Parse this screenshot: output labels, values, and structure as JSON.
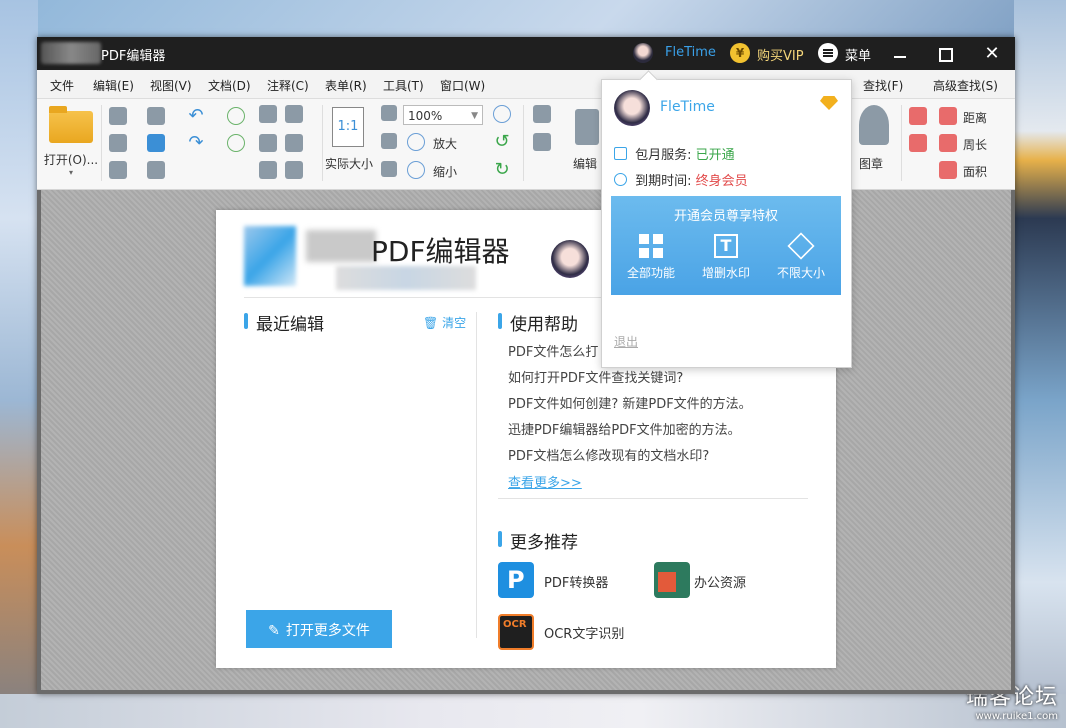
{
  "window": {
    "title": "PDF编辑器",
    "user_name": "FleTime",
    "vip_label": "购买VIP",
    "vip_icon_text": "¥",
    "menu_label": "菜单",
    "min_label": "",
    "close_label": "✕"
  },
  "menubar": {
    "items": [
      "文件",
      "编辑(E)",
      "视图(V)",
      "文档(D)",
      "注释(C)",
      "表单(R)",
      "工具(T)",
      "窗口(W)"
    ],
    "find_label": "查找(F)",
    "adv_find_label": "高级查找(S)"
  },
  "toolbar": {
    "open_label": "打开(O)...",
    "zoom_value": "100%",
    "actual_size_label": "实际大小",
    "actual_size_icon": "1:1",
    "zoom_in_label": "放大",
    "zoom_out_label": "缩小",
    "edit_label": "编辑",
    "stamp_label": "图章",
    "distance_label": "距离",
    "perimeter_label": "周长",
    "area_label": "面积"
  },
  "start_page": {
    "title": "PDF编辑器",
    "recent_heading": "最近编辑",
    "clear_label": "清空",
    "help_heading": "使用帮助",
    "help_items": [
      "PDF文件怎么打",
      "如何打开PDF文件查找关键词?",
      "PDF文件如何创建? 新建PDF文件的方法。",
      "迅捷PDF编辑器给PDF文件加密的方法。",
      "PDF文档怎么修改现有的文档水印?"
    ],
    "more_link": "查看更多>>",
    "recommend_heading": "更多推荐",
    "recommend": {
      "pdf_converter": "PDF转换器",
      "office": "办公资源",
      "ocr": "OCR文字识别"
    },
    "open_more_button": "打开更多文件"
  },
  "popup": {
    "name": "FleTime",
    "monthly_label": "包月服务:",
    "monthly_value": "已开通",
    "expire_label": "到期时间:",
    "expire_value": "终身会员",
    "vip_title": "开通会员尊享特权",
    "features": [
      "全部功能",
      "增删水印",
      "不限大小"
    ],
    "logout": "退出"
  },
  "watermark": {
    "main": "瑞客论坛",
    "sub": "www.ruike1.com"
  },
  "colors": {
    "accent": "#3ba5e8",
    "titlebar": "#1f1f1f",
    "vip_gold": "#f2c230",
    "status_green": "#3aa64a",
    "status_red": "#e24b4b"
  }
}
